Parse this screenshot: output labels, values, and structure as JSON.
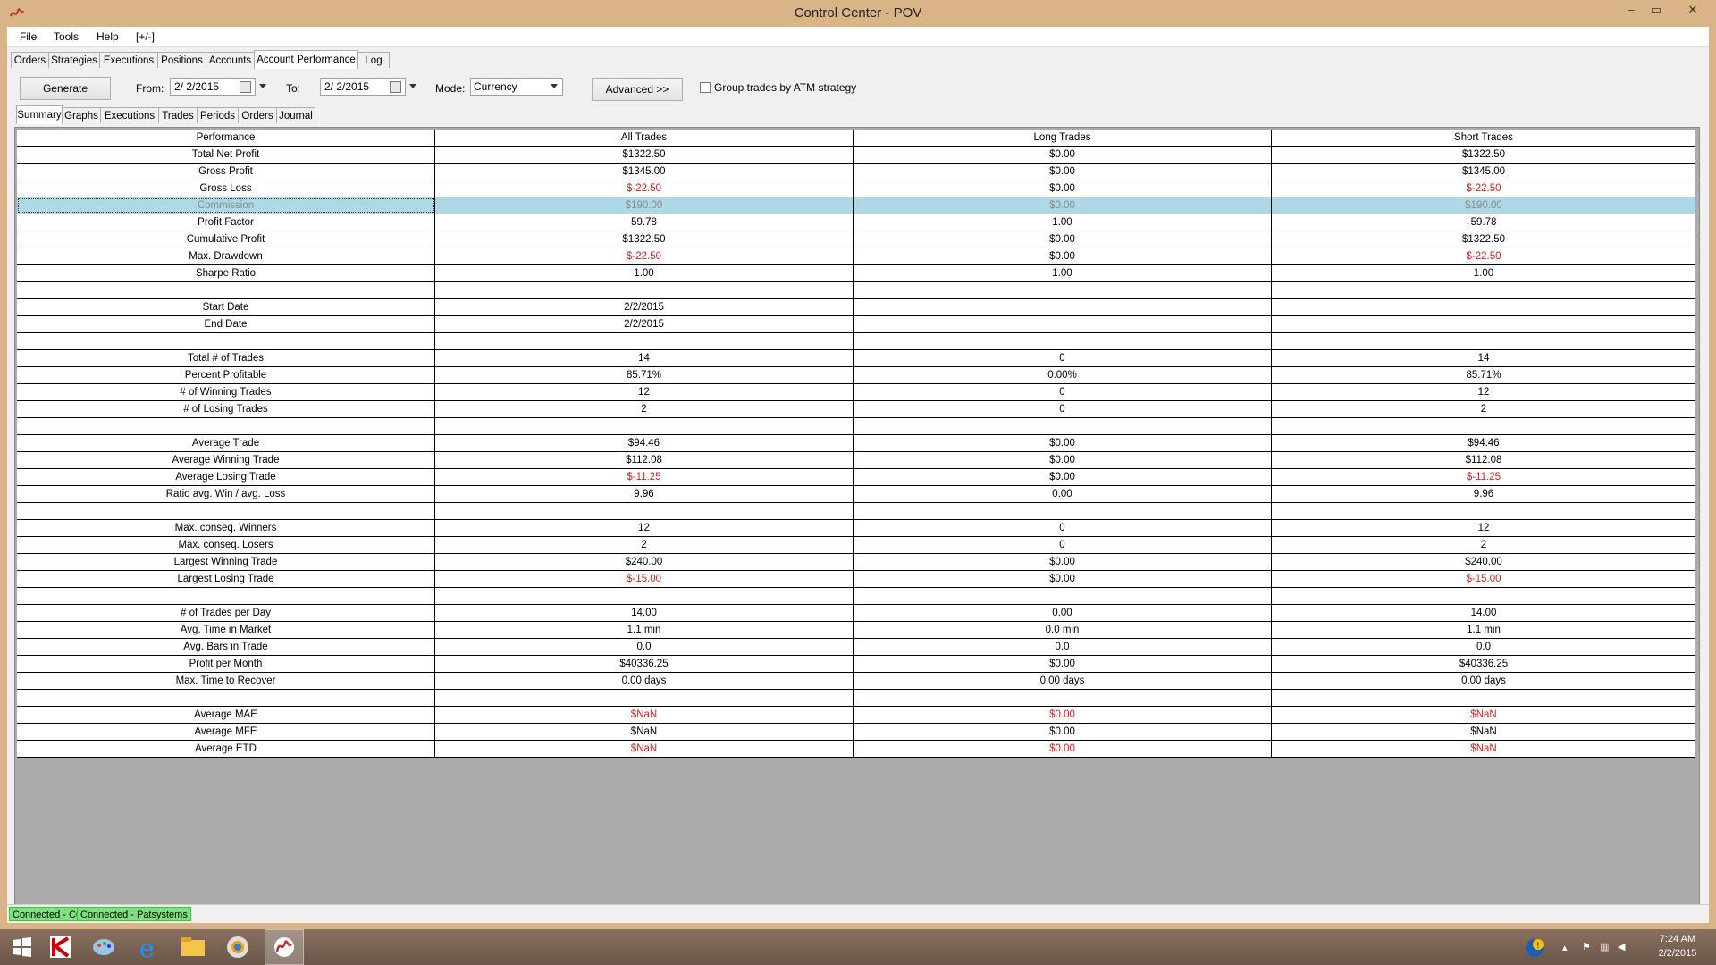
{
  "window": {
    "title": "Control Center - POV",
    "min_label": "–",
    "max_label": "▭",
    "close_label": "✕"
  },
  "menu": [
    "File",
    "Tools",
    "Help",
    "[+/-]"
  ],
  "main_tabs": [
    {
      "label": "Orders"
    },
    {
      "label": "Strategies"
    },
    {
      "label": "Executions"
    },
    {
      "label": "Positions"
    },
    {
      "label": "Accounts"
    },
    {
      "label": "Account Performance",
      "selected": true
    },
    {
      "label": "Log"
    }
  ],
  "toolbar": {
    "generate_label": "Generate",
    "from_label": "From:",
    "from_value": "2/ 2/2015",
    "to_label": "To:",
    "to_value": "2/ 2/2015",
    "mode_label": "Mode:",
    "mode_value": "Currency",
    "advanced_label": "Advanced >>",
    "group_label": "Group trades by ATM strategy",
    "group_checked": false
  },
  "sub_tabs": [
    {
      "label": "Summary",
      "selected": true
    },
    {
      "label": "Graphs"
    },
    {
      "label": "Executions"
    },
    {
      "label": "Trades"
    },
    {
      "label": "Periods"
    },
    {
      "label": "Orders"
    },
    {
      "label": "Journal"
    }
  ],
  "table": {
    "headers": [
      "Performance",
      "All Trades",
      "Long Trades",
      "Short Trades"
    ],
    "rows": [
      {
        "label": "Total Net Profit",
        "all": "$1322.50",
        "long": "$0.00",
        "short": "$1322.50"
      },
      {
        "label": "Gross Profit",
        "all": "$1345.00",
        "long": "$0.00",
        "short": "$1345.00"
      },
      {
        "label": "Gross Loss",
        "all": "$-22.50",
        "long": "$0.00",
        "short": "$-22.50",
        "neg": [
          true,
          false,
          true
        ]
      },
      {
        "label": "Commission",
        "all": "$190.00",
        "long": "$0.00",
        "short": "$190.00",
        "selected": true
      },
      {
        "label": "Profit Factor",
        "all": "59.78",
        "long": "1.00",
        "short": "59.78"
      },
      {
        "label": "Cumulative Profit",
        "all": "$1322.50",
        "long": "$0.00",
        "short": "$1322.50"
      },
      {
        "label": "Max. Drawdown",
        "all": "$-22.50",
        "long": "$0.00",
        "short": "$-22.50",
        "neg": [
          true,
          false,
          true
        ]
      },
      {
        "label": "Sharpe Ratio",
        "all": "1.00",
        "long": "1.00",
        "short": "1.00"
      },
      {
        "label": "",
        "all": "",
        "long": "",
        "short": ""
      },
      {
        "label": "Start Date",
        "all": "2/2/2015",
        "long": "",
        "short": ""
      },
      {
        "label": "End Date",
        "all": "2/2/2015",
        "long": "",
        "short": ""
      },
      {
        "label": "",
        "all": "",
        "long": "",
        "short": ""
      },
      {
        "label": "Total # of Trades",
        "all": "14",
        "long": "0",
        "short": "14"
      },
      {
        "label": "Percent Profitable",
        "all": "85.71%",
        "long": "0.00%",
        "short": "85.71%"
      },
      {
        "label": "# of Winning Trades",
        "all": "12",
        "long": "0",
        "short": "12"
      },
      {
        "label": "# of Losing Trades",
        "all": "2",
        "long": "0",
        "short": "2"
      },
      {
        "label": "",
        "all": "",
        "long": "",
        "short": ""
      },
      {
        "label": "Average Trade",
        "all": "$94.46",
        "long": "$0.00",
        "short": "$94.46"
      },
      {
        "label": "Average Winning Trade",
        "all": "$112.08",
        "long": "$0.00",
        "short": "$112.08"
      },
      {
        "label": "Average Losing Trade",
        "all": "$-11.25",
        "long": "$0.00",
        "short": "$-11.25",
        "neg": [
          true,
          false,
          true
        ]
      },
      {
        "label": "Ratio avg. Win / avg. Loss",
        "all": "9.96",
        "long": "0.00",
        "short": "9.96"
      },
      {
        "label": "",
        "all": "",
        "long": "",
        "short": ""
      },
      {
        "label": "Max. conseq. Winners",
        "all": "12",
        "long": "0",
        "short": "12"
      },
      {
        "label": "Max. conseq. Losers",
        "all": "2",
        "long": "0",
        "short": "2"
      },
      {
        "label": "Largest Winning Trade",
        "all": "$240.00",
        "long": "$0.00",
        "short": "$240.00"
      },
      {
        "label": "Largest Losing Trade",
        "all": "$-15.00",
        "long": "$0.00",
        "short": "$-15.00",
        "neg": [
          true,
          false,
          true
        ]
      },
      {
        "label": "",
        "all": "",
        "long": "",
        "short": ""
      },
      {
        "label": "# of Trades per Day",
        "all": "14.00",
        "long": "0.00",
        "short": "14.00"
      },
      {
        "label": "Avg. Time in Market",
        "all": "1.1 min",
        "long": "0.0 min",
        "short": "1.1 min"
      },
      {
        "label": "Avg. Bars in Trade",
        "all": "0.0",
        "long": "0.0",
        "short": "0.0"
      },
      {
        "label": "Profit per Month",
        "all": "$40336.25",
        "long": "$0.00",
        "short": "$40336.25"
      },
      {
        "label": "Max. Time to Recover",
        "all": "0.00 days",
        "long": "0.00 days",
        "short": "0.00 days"
      },
      {
        "label": "",
        "all": "",
        "long": "",
        "short": ""
      },
      {
        "label": "Average MAE",
        "all": "$NaN",
        "long": "$0.00",
        "short": "$NaN",
        "neg": [
          true,
          true,
          true
        ]
      },
      {
        "label": "Average MFE",
        "all": "$NaN",
        "long": "$0.00",
        "short": "$NaN"
      },
      {
        "label": "Average ETD",
        "all": "$NaN",
        "long": "$0.00",
        "short": "$NaN",
        "neg": [
          true,
          true,
          true
        ]
      }
    ]
  },
  "status": [
    "Connected - CQG",
    "Connected - Patsystems"
  ],
  "taskbar": {
    "icons": [
      "windows-start-icon",
      "kaspersky-icon",
      "paint-icon",
      "internet-explorer-icon",
      "file-explorer-icon",
      "chrome-like-icon",
      "ninjatrader-icon"
    ],
    "time": "7:24 AM",
    "date": "2/2/2015"
  },
  "colors": {
    "negative": "#d81e1e",
    "selected_row": "#add8e6",
    "status_ok": "#7fe07f"
  }
}
